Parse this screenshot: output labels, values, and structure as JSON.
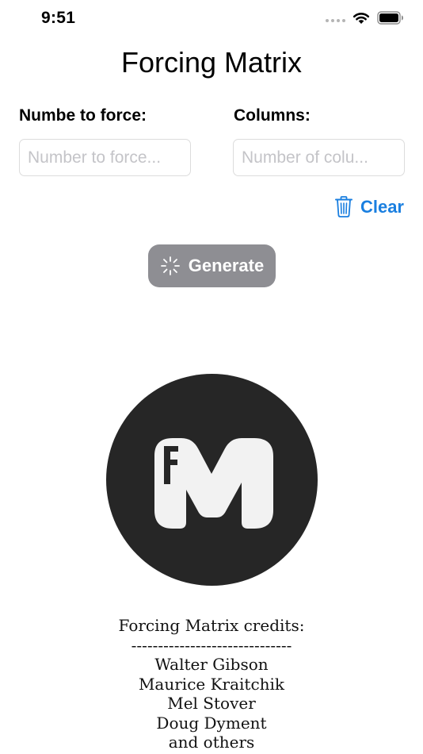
{
  "status_bar": {
    "time": "9:51"
  },
  "title": "Forcing Matrix",
  "fields": {
    "number_label": "Numbe to force:",
    "number_value": "",
    "number_placeholder": "Number to force...",
    "columns_label": "Columns:",
    "columns_value": "",
    "columns_placeholder": "Number of colu..."
  },
  "actions": {
    "clear_label": "Clear",
    "generate_label": "Generate"
  },
  "logo": {
    "letters": "FM"
  },
  "credits": {
    "heading": "Forcing Matrix credits:",
    "divider": "------------------------------",
    "names": [
      "Walter Gibson",
      "Maurice Kraitchik",
      "Mel Stover",
      "Doug Dyment",
      "and others"
    ]
  },
  "colors": {
    "accent": "#1a7fe0",
    "button_disabled": "#8e8e93",
    "logo_background": "#262626",
    "logo_letters": "#f2f2f2"
  }
}
